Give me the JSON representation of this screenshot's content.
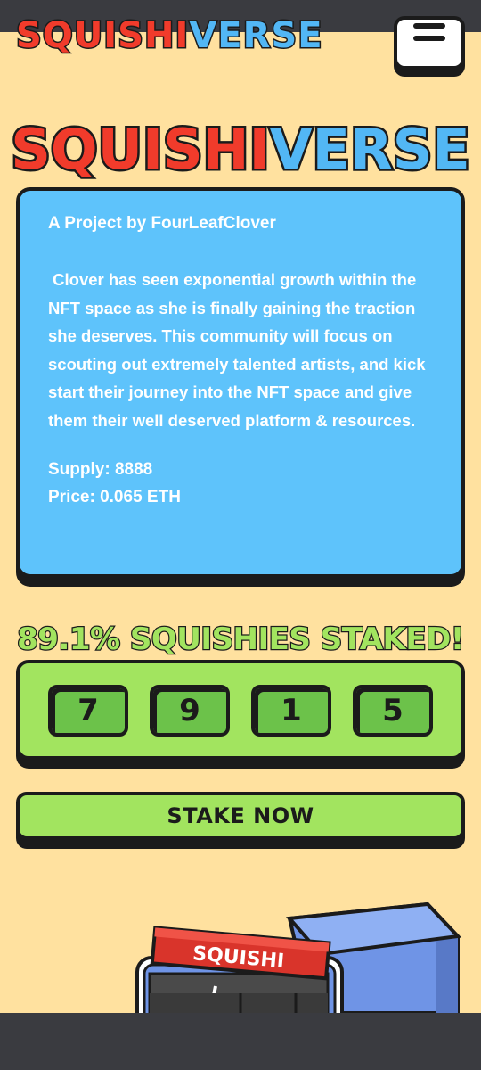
{
  "header": {
    "logo_part1": "SQUISHI",
    "logo_part2": "VERSE",
    "menu_icon": "hamburger-menu-icon"
  },
  "hero": {
    "logo_part1": "SQUISHI",
    "logo_part2": "VERSE"
  },
  "info": {
    "subtitle": "A Project by FourLeafClover",
    "description": " Clover has seen exponential growth within the NFT space as she is finally gaining the traction she deserves. This community will focus on scouting out extremely talented artists, and kick start their journey into the NFT space and give them their well deserved platform & resources.",
    "supply": "Supply: 8888",
    "price": "Price: 0.065 ETH"
  },
  "staking": {
    "title": "89.1% SQUISHIES STAKED!",
    "digits": [
      "7",
      "9",
      "1",
      "5"
    ],
    "button_label": "STAKE NOW"
  },
  "machine": {
    "sign_label": "SQUISHI"
  },
  "colors": {
    "background": "#FFE19F",
    "red": "#F13B2B",
    "blue": "#52B7F5",
    "card_blue": "#5EC3FB",
    "green": "#A2E45F",
    "dark": "#1b1b1b"
  }
}
